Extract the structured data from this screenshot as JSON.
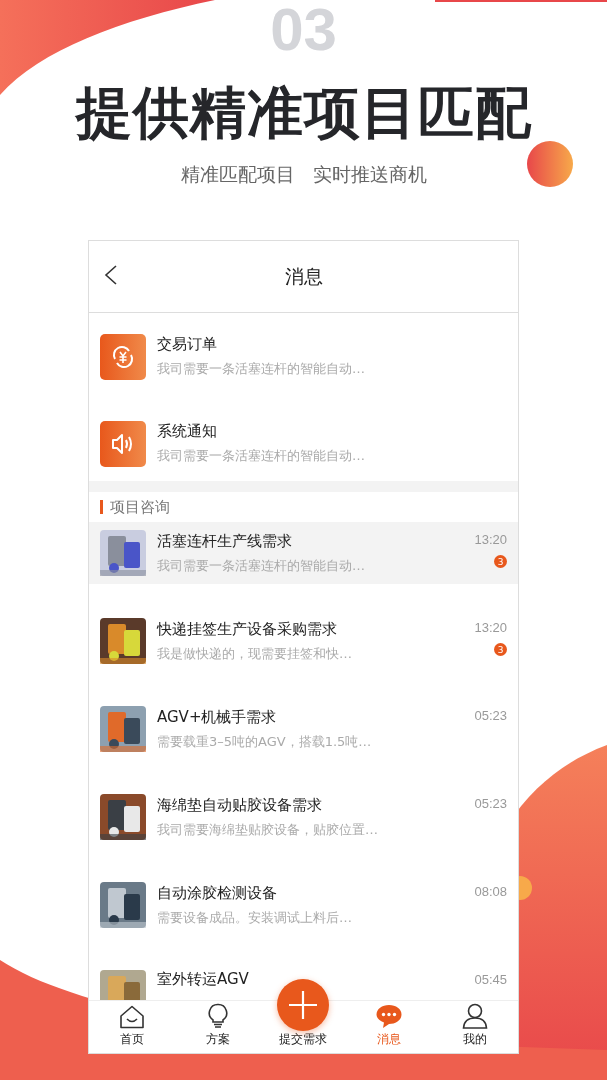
{
  "hero": {
    "number": "03",
    "title": "提供精准项目匹配",
    "subtitle": [
      "精准匹配项目",
      "实时推送商机"
    ]
  },
  "nav": {
    "title": "消息"
  },
  "system_items": [
    {
      "kind": "order",
      "title": "交易订单",
      "preview": "我司需要一条活塞连杆的智能自动…"
    },
    {
      "kind": "notice",
      "title": "系统通知",
      "preview": "我司需要一条活塞连杆的智能自动…"
    }
  ],
  "section": {
    "title": "项目咨询"
  },
  "projects": [
    {
      "title": "活塞连杆生产线需求",
      "preview": "我司需要一条活塞连杆的智能自动…",
      "time": "13:20",
      "badge": "3",
      "selected": true
    },
    {
      "title": "快递挂签生产设备采购需求",
      "preview": "我是做快递的，现需要挂签和快…",
      "time": "13:20",
      "badge": "3",
      "selected": false
    },
    {
      "title": "AGV+机械手需求",
      "preview": "需要载重3–5吨的AGV，搭载1.5吨…",
      "time": "05:23",
      "selected": false
    },
    {
      "title": "海绵垫自动贴胶设备需求",
      "preview": "我司需要海绵垫贴胶设备，贴胶位置…",
      "time": "05:23",
      "selected": false
    },
    {
      "title": "自动涂胶检测设备",
      "preview": "需要设备成品。安装调试上料后…",
      "time": "08:08",
      "selected": false
    },
    {
      "title": "室外转运AGV",
      "time": "05:45",
      "selected": false
    }
  ],
  "tabs": [
    {
      "kind": "home",
      "label": "首页",
      "selected": false
    },
    {
      "kind": "bulb",
      "label": "方案",
      "selected": false
    },
    {
      "kind": "plus",
      "label": "提交需求",
      "selected": false
    },
    {
      "kind": "chat",
      "label": "消息",
      "selected": true
    },
    {
      "kind": "person",
      "label": "我的",
      "selected": false
    }
  ]
}
